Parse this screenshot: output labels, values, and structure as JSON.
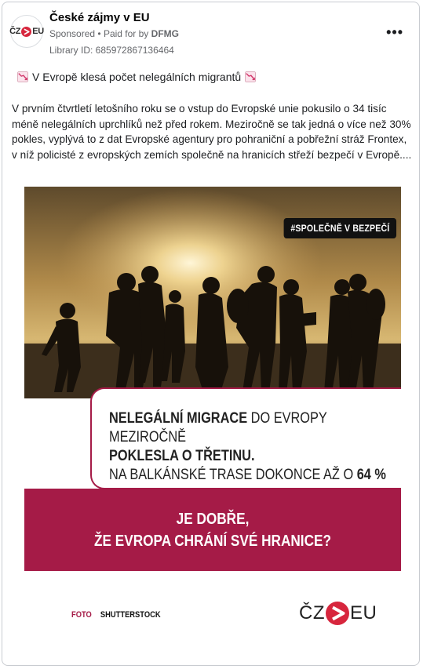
{
  "post": {
    "page_name": "České zájmy v EU",
    "sponsored": "Sponsored",
    "paid_prefix": "Paid for by",
    "payer": "DFMG",
    "separator": "•",
    "library_id": "Library ID: 685972867136464",
    "more_label": "•••",
    "avatar_logo": {
      "left": "ČZ",
      "right": "EU"
    },
    "headline": "V Evropě klesá počet nelegálních migrantů",
    "headline_icon": "chart-decreasing-icon",
    "body": "V prvním čtvrtletí letošního roku se o vstup do Evropské unie pokusilo o 34 tisíc méně nelegálních uprchlíků než před rokem. Meziročně se tak jedná o více než 30% pokles, vyplývá to z dat Evropské agentury pro pohraniční a pobřežní stráž Frontex, v níž policisté z evropských zemích společně na hranicích střeží bezpečí v Evropě...."
  },
  "creative": {
    "hashtag": "#SPOLEČNĚ V BEZPEČÍ",
    "msg_line1_bold": "NELEGÁLNÍ MIGRACE",
    "msg_line1_rest": " DO EVROPY MEZIROČNĚ",
    "msg_line2": "POKLESLA O TŘETINU.",
    "msg_line3": "NA BALKÁNSKÉ TRASE DOKONCE AŽ O ",
    "msg_line3_value": "64 %",
    "question_line1": "JE DOBŘE,",
    "question_line2": "ŽE EVROPA CHRÁNÍ SVÉ HRANICE?",
    "credit_label": "FOTO",
    "credit_value": "SHUTTERSTOCK",
    "logo_left": "ČZ",
    "logo_right": "EU",
    "colors": {
      "accent": "#a51b47",
      "dark": "#111111"
    }
  }
}
